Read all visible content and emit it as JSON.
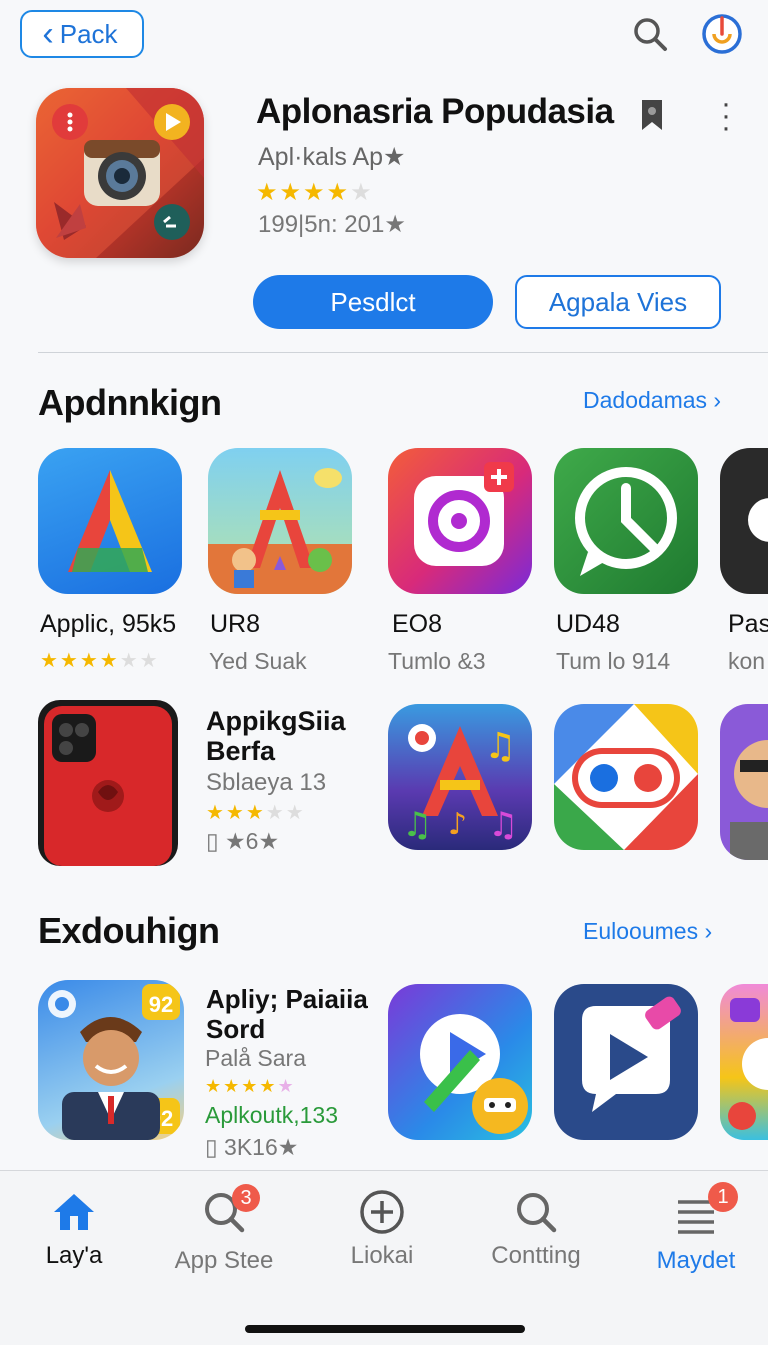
{
  "header": {
    "back_label": "Pack",
    "icons": {
      "back": "chevron-left-icon",
      "search": "search-icon",
      "profile": "profile-icon"
    }
  },
  "hero": {
    "title": "Aplonasria Popudasia",
    "subtitle": "Apl·kals Ap★",
    "rating": 4,
    "meta": "199|5n: 201★",
    "primary_button": "Pesdlct",
    "secondary_button": "Agpala Vies",
    "colors": {
      "accent": "#1e7ae8"
    }
  },
  "section1": {
    "title": "Apdnnkign",
    "link": "Dadodamas",
    "row1": [
      {
        "name": "Applic, 95k5",
        "sub": "",
        "rating": 4
      },
      {
        "name": "UR8",
        "sub": "Yed Suak"
      },
      {
        "name": "EO8",
        "sub": "Tumlo &3"
      },
      {
        "name": "UD48",
        "sub": "Tum lo 914"
      },
      {
        "name": "Pas",
        "sub": "kon"
      }
    ],
    "feature": {
      "title_line1": "AppikgSiia",
      "title_line2": "Berfa",
      "sub": "Sblaeya 13",
      "rating": 3,
      "meta": "▯ ★6★"
    }
  },
  "section2": {
    "title": "Exdouhign",
    "link": "Eulooumes",
    "feature": {
      "title_line1": "Apliy; Paiaiia",
      "title_line2": "Sord",
      "sub": "Palå Sara",
      "rating": 4,
      "green_text": "Aplkoutk,133",
      "meta": "▯ 3K16★",
      "badge_num": "92"
    }
  },
  "nav": {
    "items": [
      {
        "label": "Lay'a",
        "icon": "home-icon",
        "active": true
      },
      {
        "label": "App Stee",
        "icon": "search-icon",
        "badge": "3"
      },
      {
        "label": "Liokai",
        "icon": "plus-circle-icon"
      },
      {
        "label": "Contting",
        "icon": "search-icon"
      },
      {
        "label": "Maydet",
        "icon": "menu-icon",
        "badge": "1"
      }
    ]
  }
}
